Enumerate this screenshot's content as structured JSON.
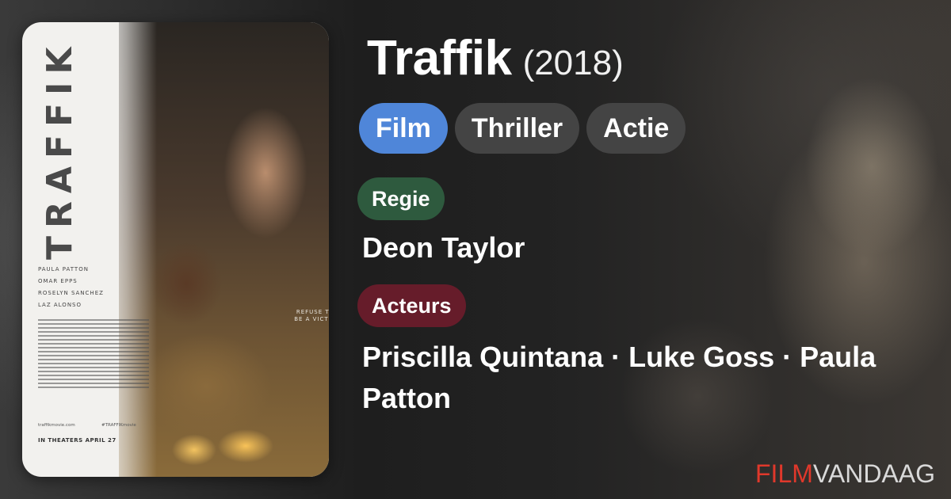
{
  "movie": {
    "title": "Traffik",
    "year": "(2018)"
  },
  "genres": [
    {
      "label": "Film",
      "active": true
    },
    {
      "label": "Thriller",
      "active": false
    },
    {
      "label": "Actie",
      "active": false
    }
  ],
  "director": {
    "label": "Regie",
    "name": "Deon Taylor"
  },
  "cast": {
    "label": "Acteurs",
    "names": "Priscilla Quintana · Luke Goss · Paula Patton"
  },
  "poster": {
    "title": "TRAFFIK",
    "cast": [
      "PAULA PATTON",
      "OMAR EPPS",
      "ROSELYN SANCHEZ",
      "LAZ ALONSO"
    ],
    "tagline": "REFUSE TO BE A VICTIM",
    "url": "traffikmovie.com",
    "hashtag": "#TRAFFIKmovie",
    "release": "IN THEATERS APRIL 27"
  },
  "brand": {
    "part1": "FILM",
    "part2": "VANDAAG"
  },
  "colors": {
    "active_pill": "#4f86d9",
    "pill": "#444444",
    "regie_label": "#2e5a3e",
    "acteurs_label": "#661c2a",
    "logo_red": "#e0382b"
  }
}
